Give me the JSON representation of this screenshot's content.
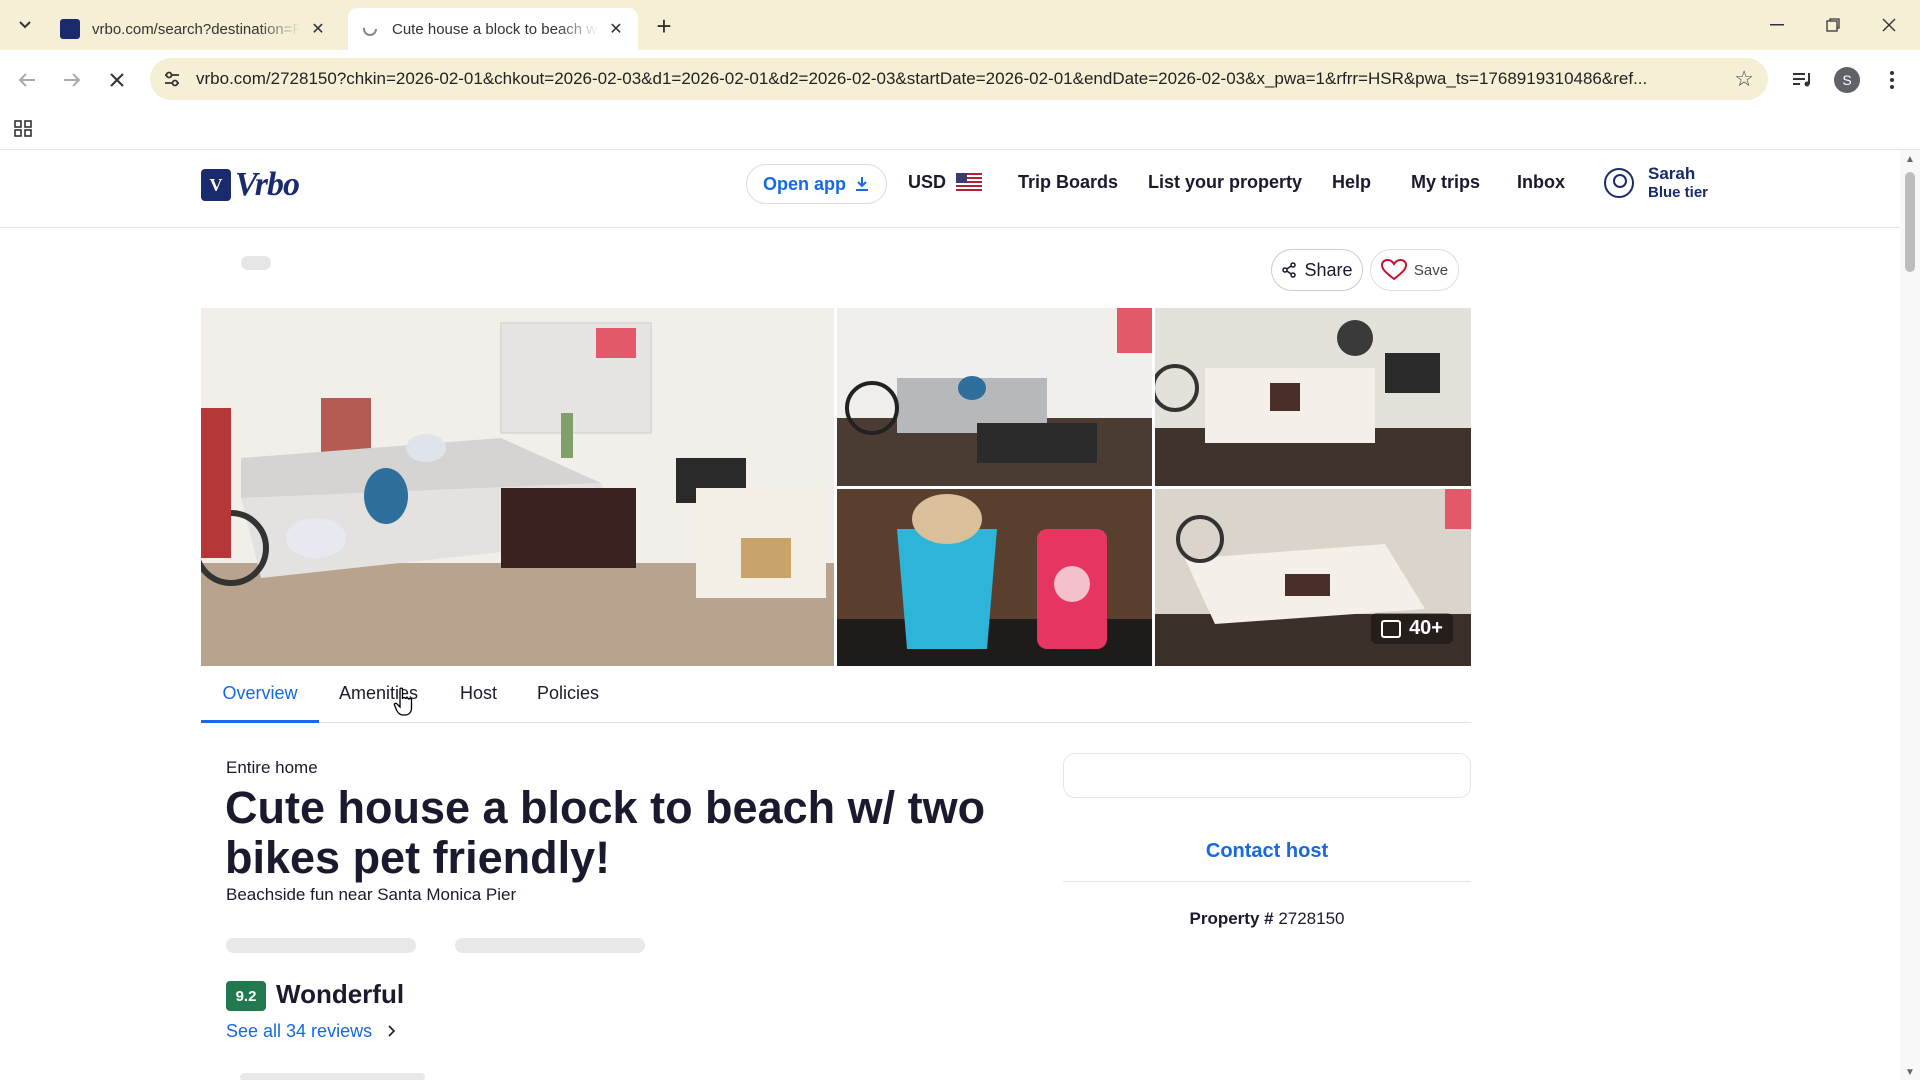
{
  "browser": {
    "tabs": [
      {
        "title": "vrbo.com/search?destination=R",
        "active": false
      },
      {
        "title": "Cute house a block to beach w/ two bikes pet friendly!",
        "active": true
      }
    ],
    "url": "vrbo.com/2728150?chkin=2026-02-01&chkout=2026-02-03&d1=2026-02-01&d2=2026-02-03&startDate=2026-02-01&endDate=2026-02-03&x_pwa=1&rfrr=HSR&pwa_ts=1768919310486&ref...",
    "profile_initial": "S"
  },
  "header": {
    "logo_text": "Vrbo",
    "open_app": "Open app",
    "currency": "USD",
    "nav": [
      "Trip Boards",
      "List your property",
      "Help",
      "My trips",
      "Inbox"
    ],
    "user_name": "Sarah",
    "user_tier": "Blue tier"
  },
  "actions": {
    "share": "Share",
    "save": "Save"
  },
  "gallery": {
    "more_count": "40+"
  },
  "section_tabs": [
    "Overview",
    "Amenities",
    "Host",
    "Policies"
  ],
  "listing": {
    "type": "Entire home",
    "title": "Cute house a block to beach w/ two bikes pet friendly!",
    "tagline": "Beachside fun near Santa Monica Pier",
    "rating": "9.2",
    "rating_word": "Wonderful",
    "reviews_link": "See all 34 reviews"
  },
  "sidebar": {
    "contact_host": "Contact host",
    "property_label": "Property #",
    "property_number": "2728150"
  },
  "colors": {
    "accent": "#1668e3",
    "brand": "#1a2b6d",
    "rating_green": "#227950",
    "chrome_bg": "#f5f0d5"
  }
}
